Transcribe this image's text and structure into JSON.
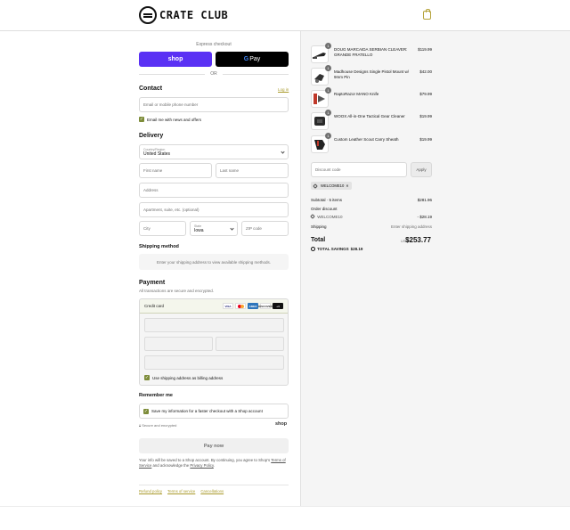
{
  "header": {
    "brand": "CRATE CLUB"
  },
  "express": {
    "label": "Express checkout",
    "shop_label": "shop",
    "gpay_g": "G",
    "gpay_label": "Pay",
    "or_label": "OR"
  },
  "contact": {
    "title": "Contact",
    "login_label": "Log in",
    "email_placeholder": "Email or mobile phone number",
    "newsletter_label": "Email me with news and offers"
  },
  "delivery": {
    "title": "Delivery",
    "country_label": "Country/Region",
    "country_value": "United States",
    "first_name": "First name",
    "last_name": "Last name",
    "address": "Address",
    "apartment": "Apartment, suite, etc. (optional)",
    "city": "City",
    "state_label": "State",
    "state_value": "Iowa",
    "zip": "ZIP code"
  },
  "shipping_method": {
    "title": "Shipping method",
    "notice": "Enter your shipping address to view available shipping methods."
  },
  "payment": {
    "title": "Payment",
    "subtitle": "All transactions are secure and encrypted.",
    "credit_card_label": "Credit card",
    "cards": [
      "VISA",
      "",
      "AMEX",
      "DISCOVER",
      "+4"
    ],
    "billing_label": "Use shipping address as billing address"
  },
  "remember": {
    "title": "Remember me",
    "save_label": "Save my information for a faster checkout with a Shop account",
    "secure_label": "Secure and encrypted",
    "shop_brand": "shop"
  },
  "pay_now": "Pay now",
  "legal": {
    "before": "Your info will be saved to a Shop account. By continuing, you agree to Shop's",
    "terms": "Terms of Service",
    "middle": "and acknowledge the",
    "privacy": "Privacy Policy",
    "end": "."
  },
  "footer_links": [
    "Refund policy",
    "Terms of service",
    "Cancellations"
  ],
  "order": {
    "items": [
      {
        "qty": "1",
        "name": "DOUG MARCAIDA SERBIAN CLEAVER: GRANDE FRATELLO",
        "price": "$119.99"
      },
      {
        "qty": "1",
        "name": "Madhouse Designs Single Pistol Mount w/ 9mm Pin",
        "price": "$42.00"
      },
      {
        "qty": "1",
        "name": "RaptoRazor MANO Knife",
        "price": "$79.99"
      },
      {
        "qty": "1",
        "name": "WOOX All-in-One Tactical Gear Cleaner",
        "price": "$19.99"
      },
      {
        "qty": "1",
        "name": "Custom Leather Scout Carry Sheath",
        "price": "$19.99"
      }
    ],
    "discount_placeholder": "Discount code",
    "apply_label": "Apply",
    "applied_code": "WELCOME10",
    "remove_glyph": "✕",
    "subtotal_label": "Subtotal · 5 items",
    "subtotal_value": "$281.96",
    "order_discount_label": "Order discount",
    "discount_code": "WELCOME10",
    "discount_value": "- $28.19",
    "shipping_label": "Shipping",
    "shipping_value": "Enter shipping address",
    "total_label": "Total",
    "currency": "USD",
    "total_value": "$253.77",
    "savings_label": "TOTAL SAVINGS",
    "savings_value": "$28.19"
  }
}
